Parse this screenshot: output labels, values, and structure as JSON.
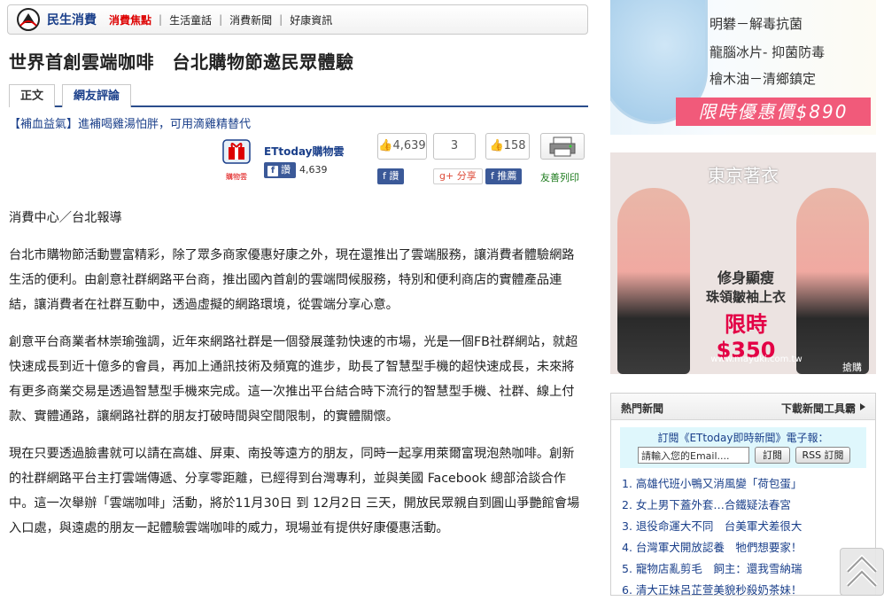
{
  "topnav": {
    "brand": "民生消費",
    "items": [
      {
        "label": "消費焦點",
        "active": true
      },
      {
        "label": "生活童話",
        "active": false
      },
      {
        "label": "消費新聞",
        "active": false
      },
      {
        "label": "好康資訊",
        "active": false
      }
    ],
    "separator": "|"
  },
  "article": {
    "title": "世界首創雲端咖啡　台北購物節邀民眾體驗",
    "tabs": [
      "正文",
      "網友評論"
    ],
    "promo": "【補血益氣】進補喝雞湯怕胖，可用滴雞精替代",
    "byline": "消費中心／台北報導",
    "paragraphs": [
      "台北市購物節活動豐富精彩，除了眾多商家優惠好康之外，現在還推出了雲端服務，讓消費者體驗網路生活的便利。由創意社群網路平台商，推出國內首創的雲端問候服務，特別和便利商店的實體產品連結，讓消費者在社群互動中，透過虛擬的網路環境，從雲端分享心意。",
      "創意平台商業者林崇瑜強調，近年來網路社群是一個發展蓬勃快速的市場，光是一個FB社群網站，就超快速成長到近十億多的會員，再加上通訊技術及頻寬的進步，助長了智慧型手機的超快速成長，未來將有更多商業交易是透過智慧型手機來完成。這一次推出平台結合時下流行的智慧型手機、社群、線上付款、實體通路，讓網路社群的朋友打破時間與空間限制，的實體關懷。",
      "現在只要透過臉書就可以請在高雄、屏東、南投等遠方的朋友，同時一起享用萊爾富現泡熱咖啡。創新的社群網路平台主打雲端傳遞、分享零距離，已經得到台灣專利，並與美國 Facebook 總部洽談合作中。這一次舉辦「雲端咖啡」活動，將於11月30日 到 12月2日 三天，開放民眾親自到圓山爭艷館會場入口處，與遠處的朋友一起體驗雲端咖啡的威力，現場並有提供好康優惠活動。"
    ]
  },
  "share": {
    "et_name": "ETtoday購物雲",
    "fb_like_label": "讚",
    "fb_like_count": "4,639",
    "like_count": "4,639",
    "plus_count": "3",
    "recommend_count": "158",
    "like_btn": "讚",
    "gplus_btn": "分享",
    "recommend_btn": "推薦",
    "print_label": "友善列印",
    "logo_caption": "購物雲"
  },
  "sidebar": {
    "ad1": {
      "rows": [
        "明礬－解毒抗菌",
        "龍腦冰片- 抑菌防毒",
        "檜木油－清鄉鎮定"
      ],
      "price": "限時優惠價$890"
    },
    "ad2": {
      "brand": "東京著衣",
      "line1": "修身顯瘦",
      "line2": "珠領皺袖上衣",
      "line3": "限時$350",
      "url": "www.mayuki.com.tw",
      "buy": "搶購"
    },
    "hot": {
      "title": "熱門新聞",
      "link": "下載新聞工具霸",
      "subscribe_title": "訂閱《ETtoday即時新聞》電子報：",
      "email_placeholder": "請輸入您的Email....",
      "subscribe_btn": "訂閱",
      "rss_btn": "RSS 訂閱",
      "items": [
        "1. 高雄代班小鴨又消風變「荷包蛋」",
        "2. 女上男下蓋外套…合鐵疑法春宮",
        "3. 退役命運大不同　台美軍犬差很大",
        "4. 台灣軍犬開放認養　牠們想要家！",
        "5. 寵物店亂剪毛　飼主：還我雪納瑞",
        "6. 清大正妹呂芷萱美貌秒殺奶茶妹！"
      ]
    }
  }
}
